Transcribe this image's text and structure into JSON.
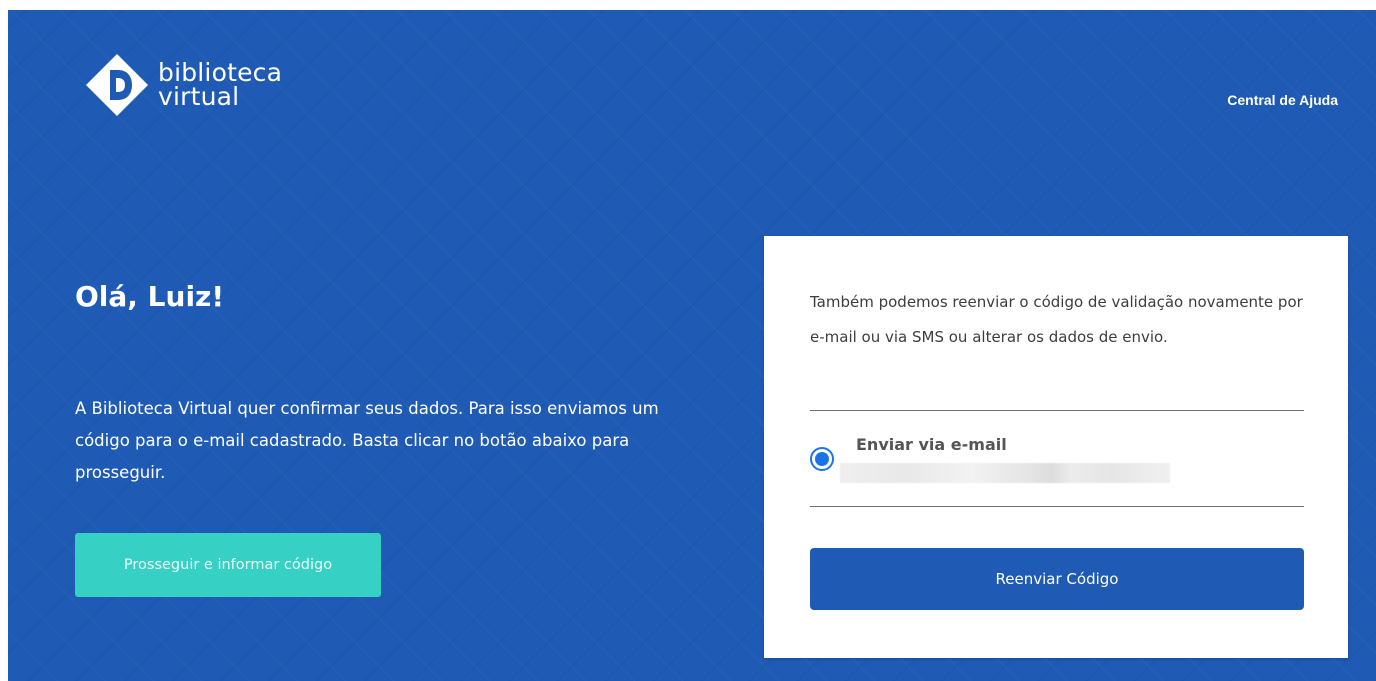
{
  "header": {
    "logo": {
      "line1": "biblioteca",
      "line2": "virtual",
      "icon": "biblioteca-virtual-logo-icon"
    },
    "help_link": "Central de Ajuda"
  },
  "hero": {
    "greeting": "Olá, Luiz!",
    "description": "A Biblioteca Virtual quer confirmar seus dados. Para isso enviamos um código para o e-mail cadastrado. Basta clicar no botão abaixo para prosseguir.",
    "primary_button": "Prosseguir e informar código"
  },
  "card": {
    "text": "Também podemos reenviar o código de validação novamente por e-mail ou via SMS ou alterar os dados de envio.",
    "option": {
      "label": "Enviar via e-mail",
      "selected": true
    },
    "resend_button": "Reenviar Código"
  },
  "colors": {
    "brand_blue": "#1f5bb4",
    "accent_teal": "#37d0c4",
    "radio_blue": "#1a73e8"
  }
}
